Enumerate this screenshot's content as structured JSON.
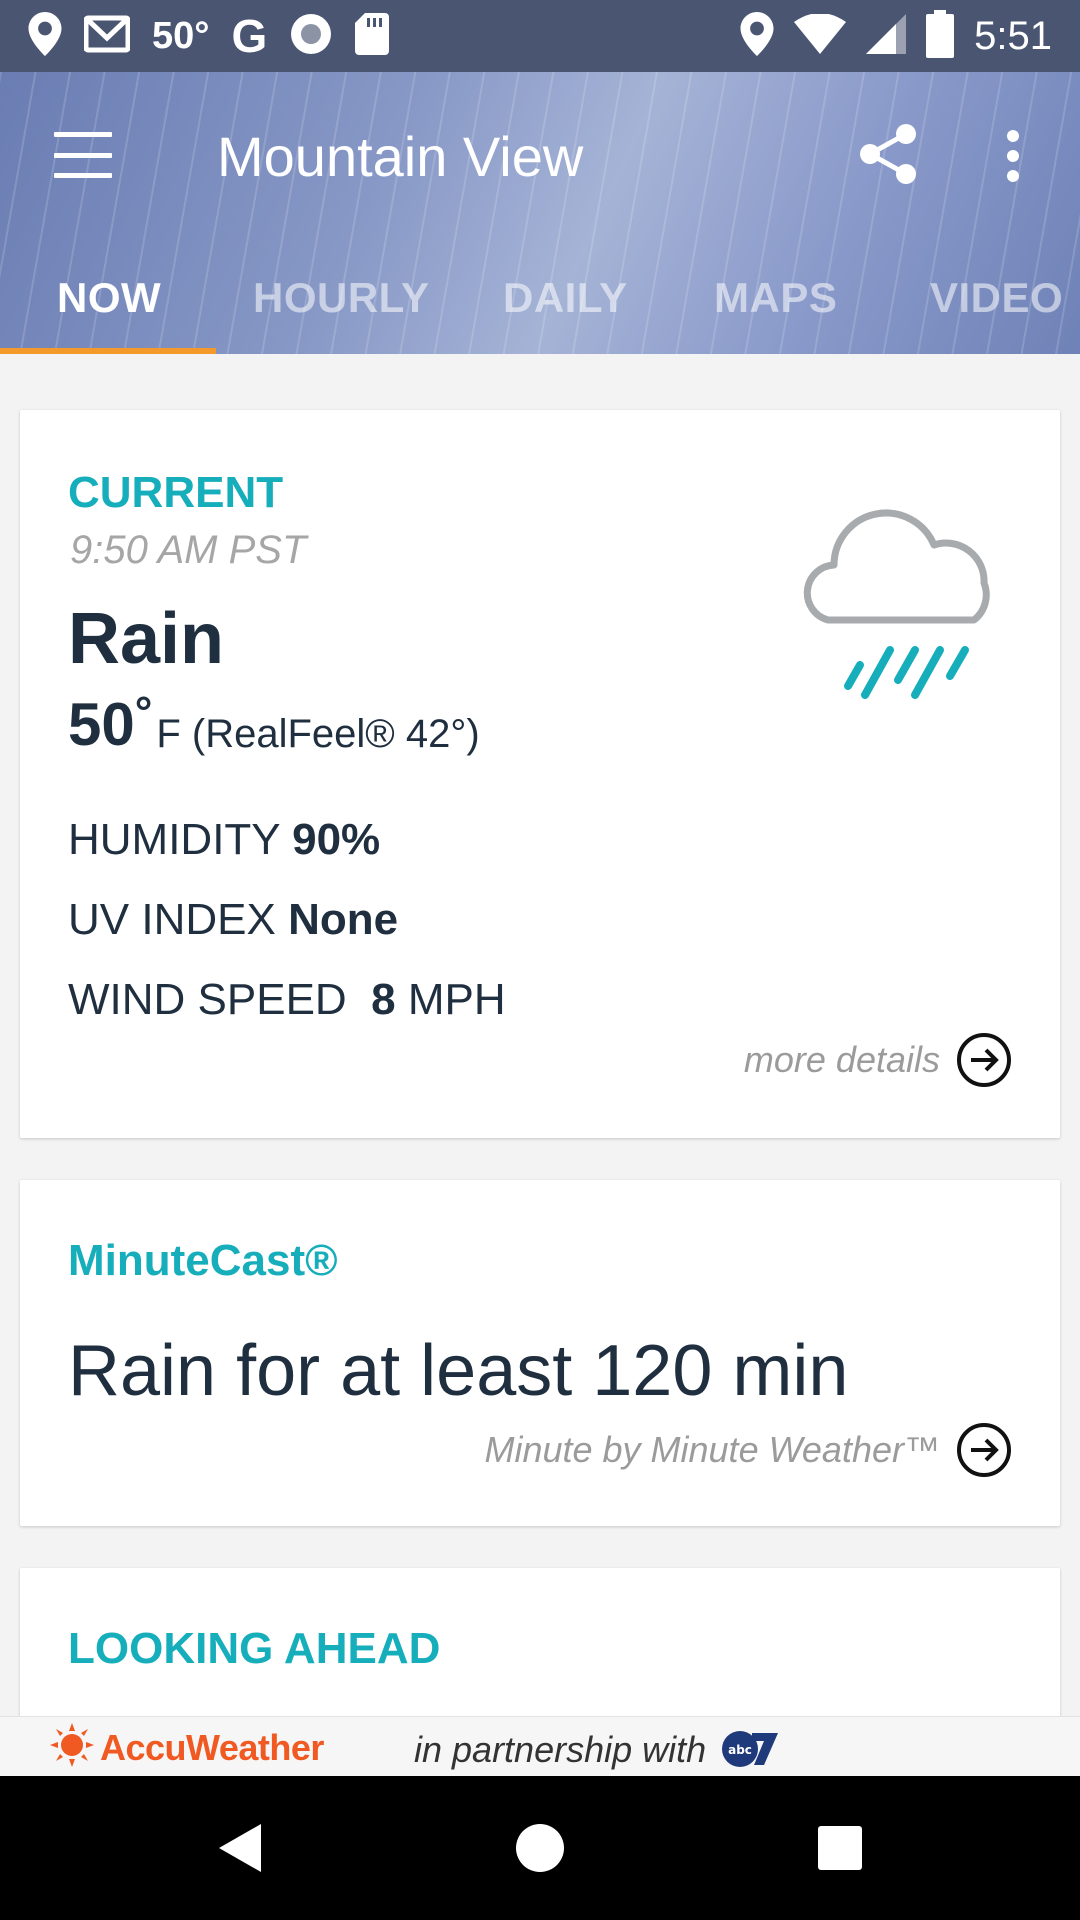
{
  "status_bar": {
    "temperature": "50°",
    "google": "G",
    "time": "5:51",
    "icons": [
      "location-icon",
      "gmail-icon",
      "google-icon",
      "record-icon",
      "sd-card-icon",
      "location-icon",
      "wifi-icon",
      "signal-icon",
      "battery-icon"
    ]
  },
  "app_bar": {
    "title": "Mountain View",
    "tabs": [
      "NOW",
      "HOURLY",
      "DAILY",
      "MAPS",
      "VIDEO"
    ],
    "active_tab": "NOW",
    "accent_color": "#f39a2a"
  },
  "current": {
    "section_title": "CURRENT",
    "time": "9:50 AM PST",
    "condition": "Rain",
    "temp": "50",
    "temp_unit": "°",
    "temp_rest": "F (RealFeel® 42°)",
    "humidity_label": "HUMIDITY",
    "humidity_value": "90%",
    "uv_label": "UV INDEX",
    "uv_value": "None",
    "wind_label": "WIND SPEED",
    "wind_value": "8",
    "wind_unit": "MPH",
    "more_details": "more details",
    "icon": "rain-cloud-icon"
  },
  "minutecast": {
    "section_title": "MinuteCast®",
    "headline": "Rain for at least 120 min",
    "subtitle": "Minute by Minute Weather™"
  },
  "looking_ahead": {
    "section_title": "LOOKING AHEAD"
  },
  "partner": {
    "brand": "AccuWeather",
    "text": "in partnership with"
  },
  "colors": {
    "teal": "#17aebc",
    "dark_text": "#1f2f3f",
    "accuweather_orange": "#f05a22"
  }
}
